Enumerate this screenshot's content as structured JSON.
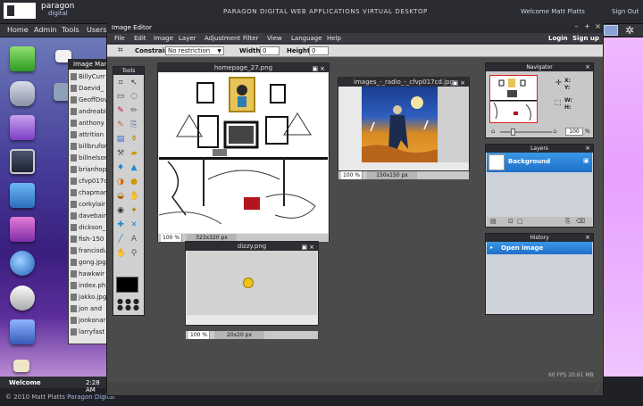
{
  "brand": {
    "logo_line1": "paragon",
    "logo_line2": "digital",
    "title": "PARAGON DIGITAL WEB APPLICATIONS VIRTUAL DESKTOP"
  },
  "header": {
    "welcome": "Welcome Matt Platts",
    "signout": "Sign Out"
  },
  "nav": [
    "Home",
    "Admin",
    "Tools",
    "Users"
  ],
  "image_manager": {
    "title": "Image Manager",
    "files": [
      "BillyCurr",
      "Daevid_",
      "GeoffDov",
      "andreabi",
      "anthony",
      "attrition",
      "billbrufor",
      "billnelsor",
      "brianhop",
      "cfvp017c",
      "chapman",
      "corkylair",
      "davebain",
      "dickson_",
      "fish-150",
      "francisdu",
      "gong.jpg",
      "hawkwir",
      "index.ph",
      "jakko.jpg",
      "jon and",
      "jonkonar",
      "larryfast"
    ]
  },
  "taskbar": {
    "welcome": "Welcome",
    "time": "2:28 AM"
  },
  "footer": {
    "copyright": "© 2010 Matt Platts",
    "company": "Paragon Digital"
  },
  "editor": {
    "title": "Image Editor",
    "controls": [
      "–",
      "+",
      "×"
    ],
    "menu": [
      "File",
      "Edit",
      "Image",
      "Layer",
      "Adjustment",
      "Filter",
      "View",
      "Language",
      "Help"
    ],
    "login": "Login",
    "signup": "Sign up",
    "options": {
      "constraint_label": "Constraint:",
      "constraint_value": "No restriction",
      "width_label": "Width:",
      "width_value": "0",
      "height_label": "Height:",
      "height_value": "0"
    },
    "status": "60 FPS 20.61 MB"
  },
  "tools_panel": {
    "title": "Tools"
  },
  "docs": [
    {
      "title": "homepage_27.png",
      "zoom": "100 %",
      "size": "323x320 px"
    },
    {
      "title": "images_-_radio_-_cfvp017cd.jpg",
      "zoom": "100 %",
      "size": "150x150 px"
    },
    {
      "title": "dizzy.png",
      "zoom": "100 %",
      "size": "20x20 px"
    }
  ],
  "navigator": {
    "title": "Navigator",
    "x_label": "X:",
    "y_label": "Y:",
    "w_label": "W:",
    "h_label": "H:",
    "zoom_value": "100",
    "zoom_unit": "%"
  },
  "layers": {
    "title": "Layers",
    "items": [
      "Background"
    ]
  },
  "history": {
    "title": "History",
    "items": [
      "Open image"
    ]
  }
}
